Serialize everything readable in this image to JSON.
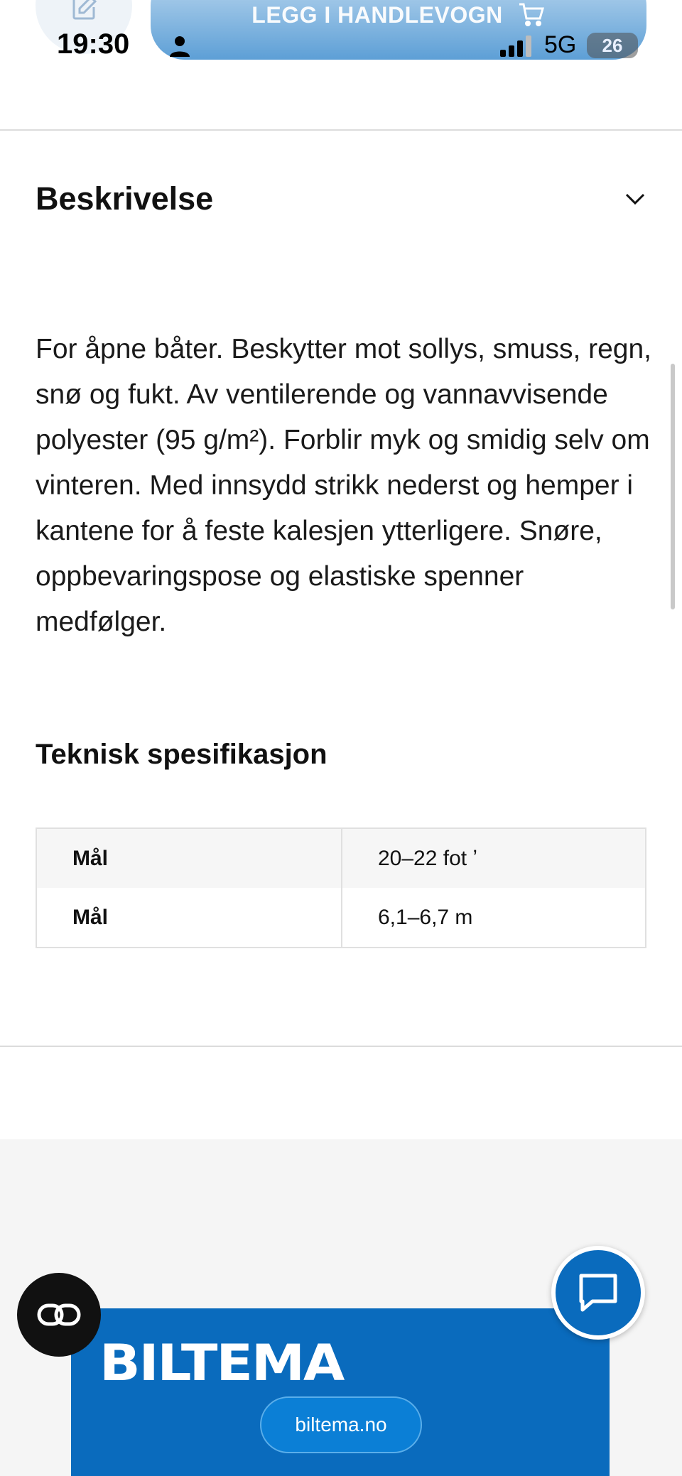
{
  "status_bar": {
    "time": "19:30",
    "network": "5G",
    "battery": "26"
  },
  "top_bar": {
    "add_to_cart_label": "LEGG I HANDLEVOGN"
  },
  "description": {
    "title": "Beskrivelse",
    "text": "For åpne båter. Beskytter mot sollys, smuss, regn, snø og fukt. Av ventilerende og vannavvisende polyester (95 g/m²). Forblir myk og smidig selv om vinteren. Med innsydd strikk nederst og hemper i kantene for å feste kalesjen ytterligere. Snøre, oppbevaringspose og elastiske spenner medfølger."
  },
  "specification": {
    "title": "Teknisk spesifikasjon",
    "rows": [
      {
        "label": "Mål",
        "value": "20–22 fot ʼ"
      },
      {
        "label": "Mål",
        "value": "6,1–6,7 m"
      }
    ]
  },
  "footer": {
    "brand_logo": "BILTEMA",
    "site_link": "biltema.no"
  },
  "icons": {
    "edit": "edit-icon",
    "cart": "cart-icon",
    "chevron": "chevron-down-icon",
    "chat": "chat-icon",
    "cookie": "cookie-settings-icon"
  },
  "colors": {
    "brand_blue": "#0a6bbd",
    "cart_button": "#5d9fd6"
  }
}
